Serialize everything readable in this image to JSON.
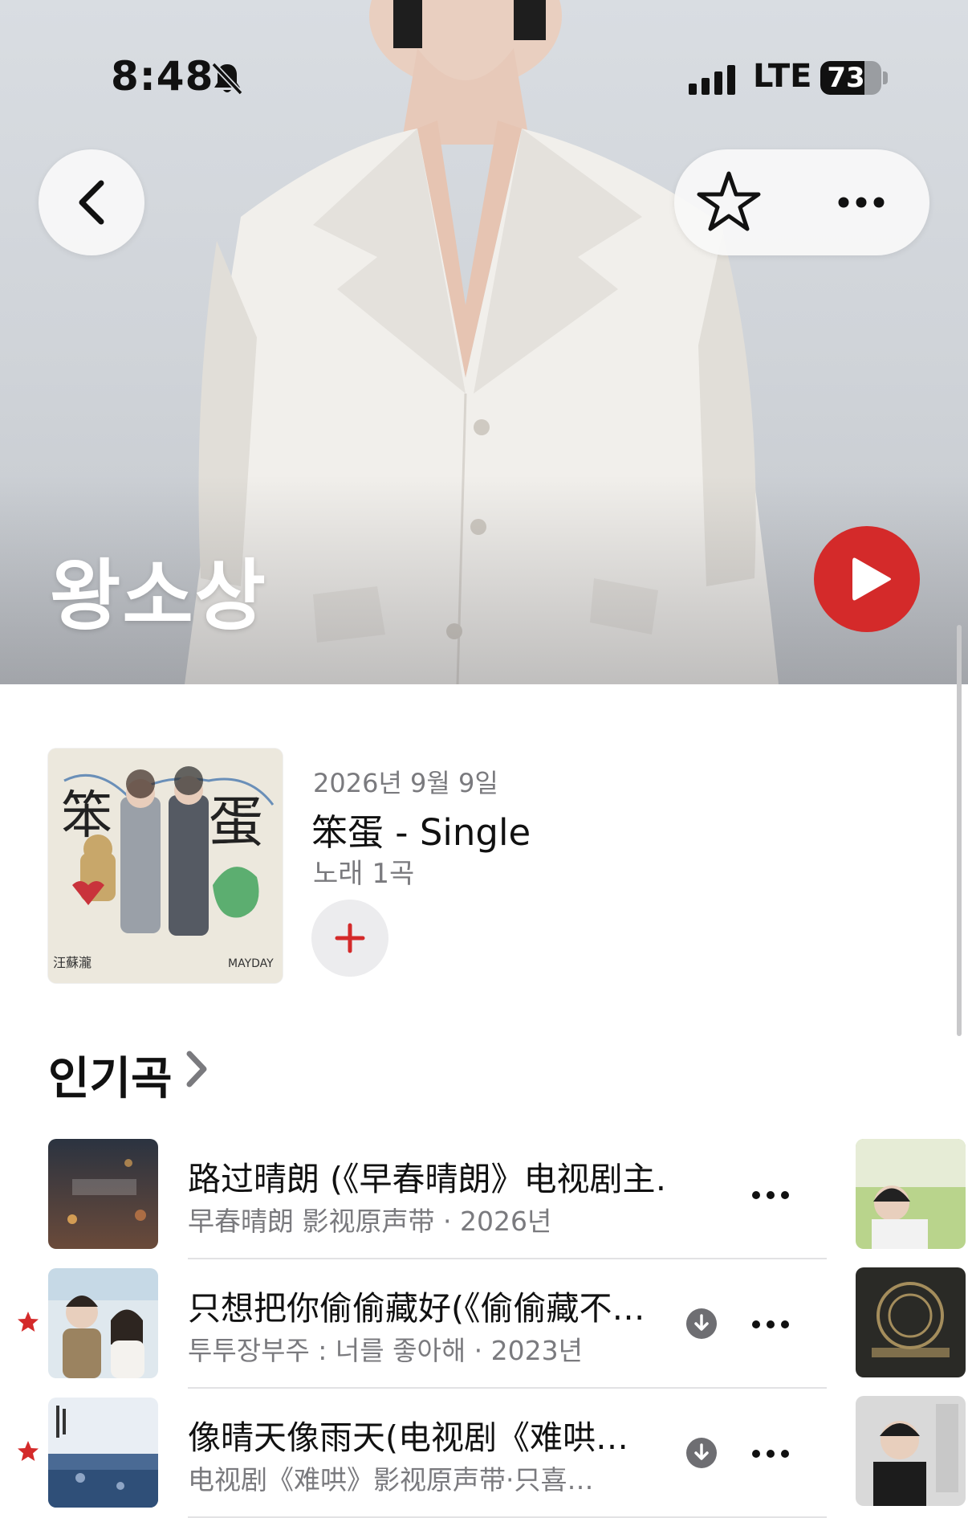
{
  "status_bar": {
    "time": "8:48",
    "network": "LTE",
    "battery": "73",
    "battery_level": 0.73
  },
  "artist": {
    "name": "왕소상"
  },
  "icons": {
    "back": "chevron-left-icon",
    "favorite": "star-outline-icon",
    "more": "ellipsis-icon",
    "play": "play-icon",
    "add": "plus-icon",
    "mute": "bell-slash-icon",
    "download": "download-circle-icon"
  },
  "colors": {
    "accent": "#d42a2a",
    "secondary_text": "#7a7a7e",
    "button_bg": "#ececee"
  },
  "latest_release": {
    "date": "2026년 9월 9일",
    "title": "笨蛋 - Single",
    "count": "노래 1곡",
    "cover": {
      "title_chars": "笨蛋",
      "caption_left": "汪蘇瀧",
      "caption_right": "MAYDAY"
    }
  },
  "top_songs": {
    "heading": "인기곡",
    "songs": [
      {
        "title": "路过晴朗 (《早春晴朗》电视剧主…",
        "subtitle": "早春晴朗 影视原声带 · 2026년",
        "starred": false,
        "downloaded": false
      },
      {
        "title": "只想把你偷偷藏好(《偷偷藏不…",
        "subtitle": "투투장부주 : 너를 좋아해 · 2023년",
        "starred": true,
        "downloaded": true
      },
      {
        "title": "像晴天像雨天(电视剧《难哄…",
        "subtitle": "电视剧《难哄》影视原声带·只喜…",
        "starred": true,
        "downloaded": true
      }
    ]
  }
}
